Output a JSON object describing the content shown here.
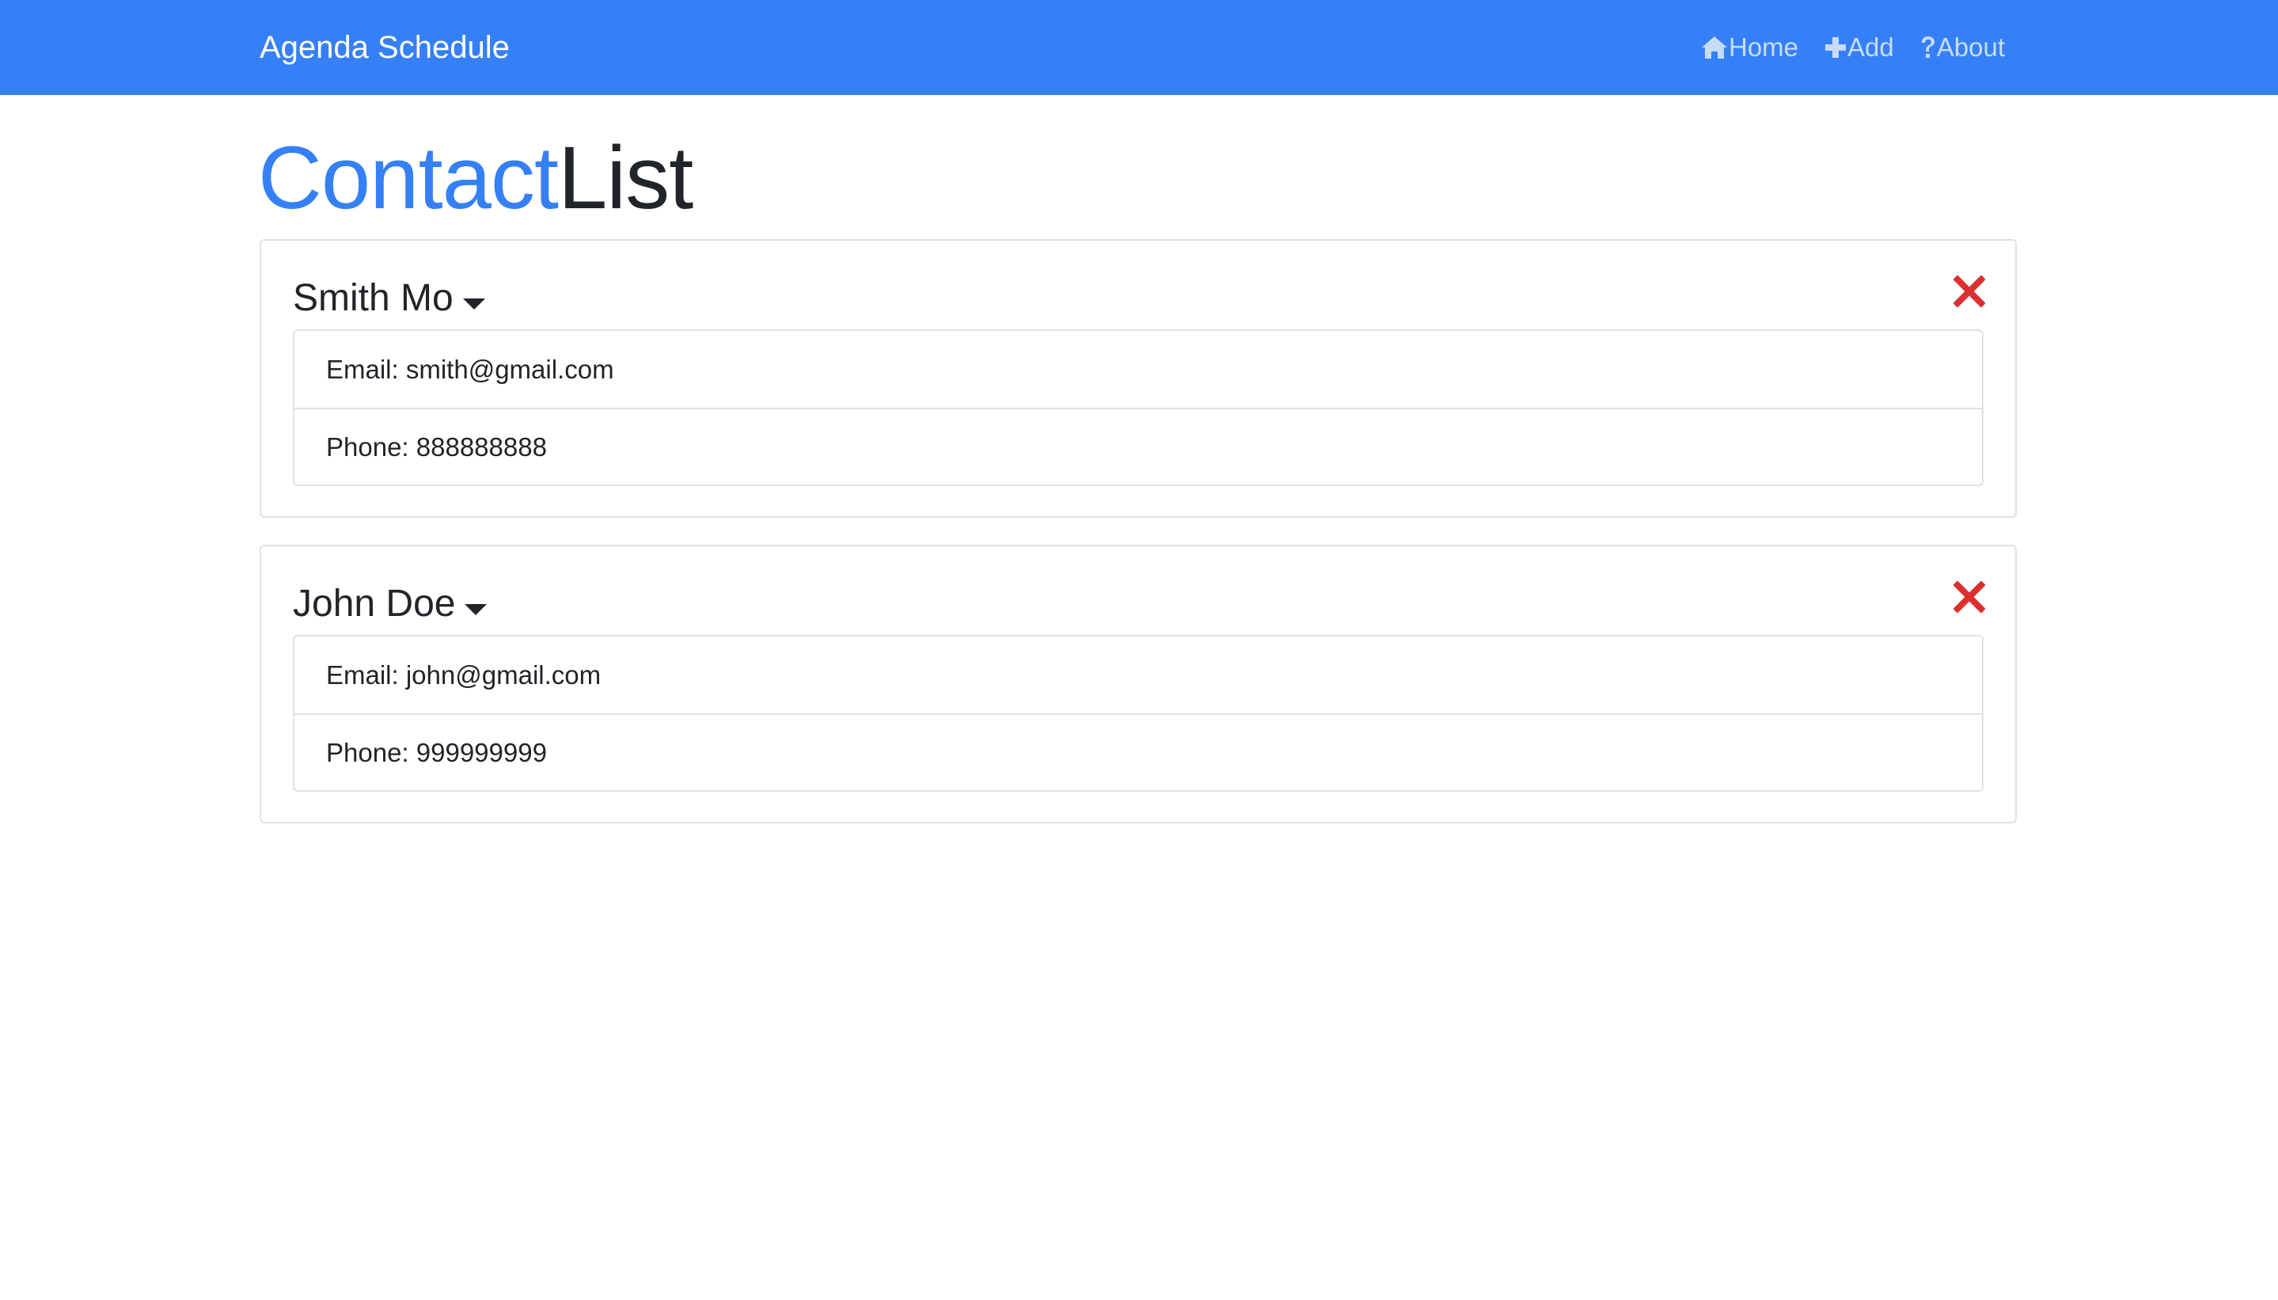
{
  "navbar": {
    "brand": "Agenda Schedule",
    "links": [
      {
        "label": "Home",
        "icon": "home-icon"
      },
      {
        "label": "Add",
        "icon": "plus-icon"
      },
      {
        "label": "About",
        "icon": "question-icon"
      }
    ]
  },
  "title": {
    "part1": "Contact",
    "part2": "List"
  },
  "contacts": [
    {
      "name": "Smith Mo",
      "email": "Email: smith@gmail.com",
      "phone": "Phone: 888888888"
    },
    {
      "name": "John Doe",
      "email": "Email: john@gmail.com",
      "phone": "Phone: 999999999"
    }
  ],
  "colors": {
    "navbar": "#3580f6",
    "accent": "#3580f6",
    "nav_link": "#c7dcfb",
    "delete": "#dc3030",
    "border": "#dfe2e5"
  }
}
